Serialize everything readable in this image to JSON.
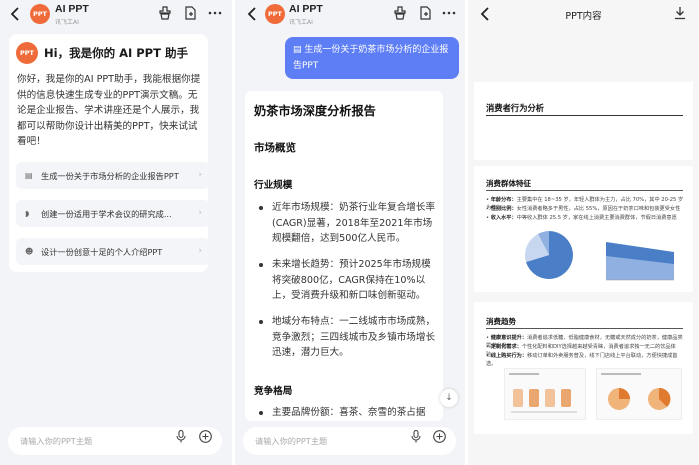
{
  "panel1": {
    "header": {
      "logo": "PPT",
      "title": "AI PPT",
      "subtitle": "讯飞工AI"
    },
    "welcome": {
      "avatar": "PPT",
      "title": "Hi，我是你的 AI PPT 助手",
      "body": "你好，我是你的AI PPT助手，我能根据你提供的信息快速生成专业的PPT演示文稿。无论是企业报告、学术讲座还是个人展示，我都可以帮助你设计出精美的PPT，快来试试看吧！"
    },
    "suggestions": [
      {
        "icon": "document-icon",
        "glyph": "▤",
        "label": "生成一份关于市场分析的企业报告PPT"
      },
      {
        "icon": "book-icon",
        "glyph": "◗",
        "label": "创建一份适用于学术会议的研究成..."
      },
      {
        "icon": "person-icon",
        "glyph": "☻",
        "label": "设计一份创意十足的个人介绍PPT"
      }
    ],
    "input_placeholder": "请输入你的PPT主题"
  },
  "panel2": {
    "header": {
      "logo": "PPT",
      "title": "AI PPT",
      "subtitle": "讯飞工AI"
    },
    "user_message": "生成一份关于奶茶市场分析的企业报告PPT",
    "report": {
      "title": "奶茶市场深度分析报告",
      "section": "市场概览",
      "subsection1": "行业规模",
      "bullets": [
        "近年市场规模：奶茶行业年复合增长率(CAGR)显著，2018年至2021年市场规模翻倍，达到500亿人民币。",
        "未来增长趋势：预计2025年市场规模将突破800亿，CAGR保持在10%以上，受消费升级和新口味创新驱动。",
        "地域分布特点：一二线城市市场成熟，竞争激烈；三四线城市及乡镇市场增长迅速，潜力巨大。"
      ],
      "subsection2": "竞争格局",
      "bullet_cut": "主要品牌份额：喜茶、奈雪的茶占据"
    },
    "input_placeholder": "请输入你的PPT主题"
  },
  "panel3": {
    "title": "PPT内容",
    "slide1": {
      "title": "消费者行为分析"
    },
    "slide2": {
      "title": "消费群体特征",
      "lines": [
        {
          "head": "年龄分布：",
          "text": "主要集中在 18~35 岁，年轻人群体为主力，占比 70%，其中 20-25 岁为核心"
        },
        {
          "head": "性别比例：",
          "text": "女性消费者略多于男性，占比 55%，原因在于奶茶口味和包装更受女性"
        },
        {
          "head": "收入水平：",
          "text": "中等收入群体 25.5 岁，家在线上消费主要消费群体，节假日消费意愿"
        }
      ]
    },
    "slide3": {
      "title": "消费趋势",
      "lines": [
        {
          "head": "健康意识提升：",
          "text": "消费者追求低糖、低脂健康食材，无糖或天然成分的奶茶，健康品类需求上升。"
        },
        {
          "head": "定制化需求：",
          "text": "个性化配料和DIY选择越来越受青睐，消费者追求独一无二的饮品体验。"
        },
        {
          "head": "线上购买行为：",
          "text": "移动订单和外卖服务普及，线下门店线上平台联动，方便快捷成首选。"
        }
      ]
    }
  },
  "colors": {
    "accent": "#5e7ef5",
    "logo": "#ef6c3a",
    "panel_bg": "#f3f4f8",
    "chart_blue": "#4a7fc8"
  }
}
